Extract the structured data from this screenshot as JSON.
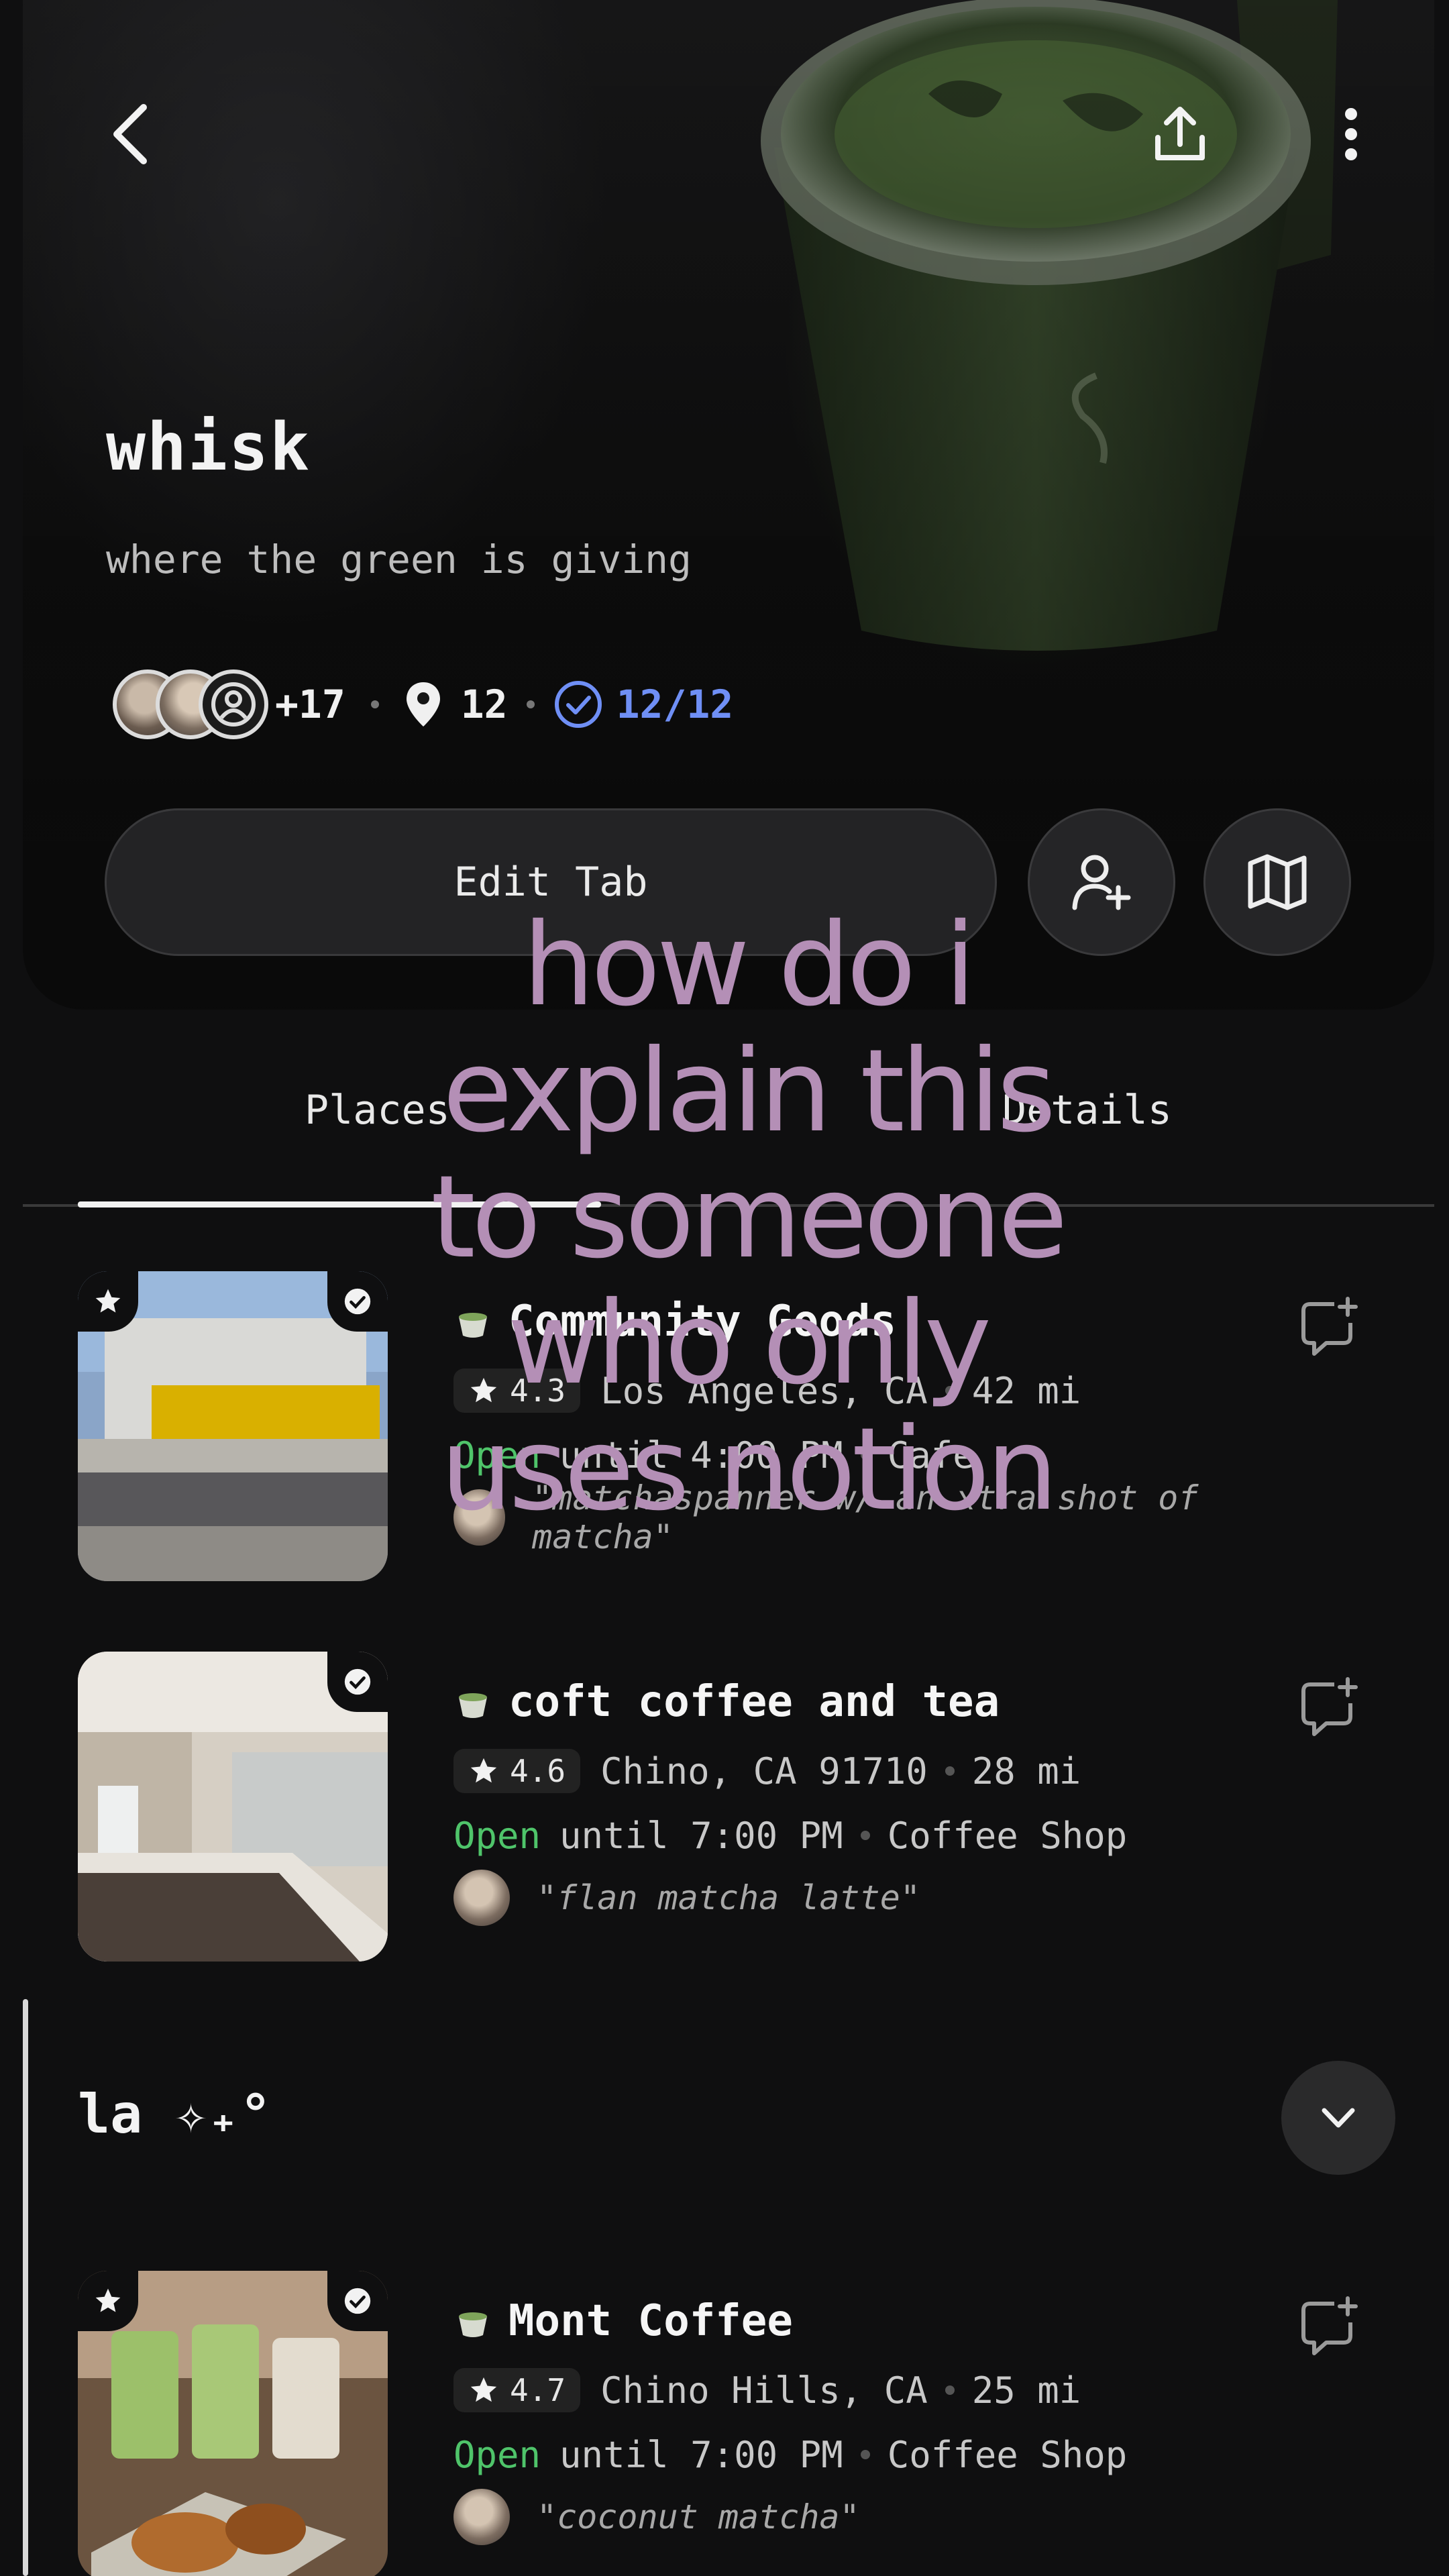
{
  "header": {
    "title": "whisk",
    "subtitle": "where the green is giving",
    "stats": {
      "members_more": "+17",
      "places_count": "12",
      "visited": "12/12"
    },
    "edit_button": "Edit Tab"
  },
  "tabs": [
    {
      "label": "Places",
      "active": true
    },
    {
      "label": "Details",
      "active": false
    }
  ],
  "places": [
    {
      "name": "Community Goods",
      "rating": "4.3",
      "location": "Los Angeles, CA",
      "distance": "42 mi",
      "status": "Open",
      "hours": "until 4:00 PM",
      "category": "Cafe",
      "quote": "\"matchaspanner w/ an xtra shot of matcha\""
    },
    {
      "name": "coft coffee and tea",
      "rating": "4.6",
      "location": "Chino, CA 91710",
      "distance": "28 mi",
      "status": "Open",
      "hours": "until 7:00 PM",
      "category": "Coffee Shop",
      "quote": "\"flan matcha latte\""
    }
  ],
  "section": {
    "title": "la ✧₊°",
    "places": [
      {
        "name": "Mont Coffee",
        "rating": "4.7",
        "location": "Chino Hills, CA",
        "distance": "25 mi",
        "status": "Open",
        "hours": "until 7:00 PM",
        "category": "Coffee Shop",
        "quote": "\"coconut matcha\""
      }
    ]
  },
  "overlay_text": "how do i explain this to someone who only uses notion",
  "colors": {
    "accent_blue": "#6f8ff5",
    "open_green": "#4fc46a",
    "overlay": "#b48fb6",
    "background": "#0f0f10"
  }
}
